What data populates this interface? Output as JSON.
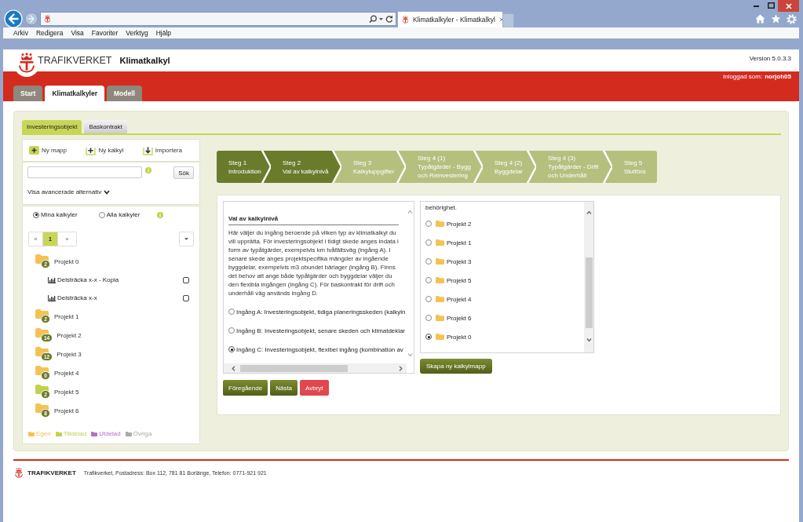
{
  "browser": {
    "tab_title": "Klimatkalkyler - Klimatkalkyl",
    "menu": [
      "Arkiv",
      "Redigera",
      "Visa",
      "Favoriter",
      "Verktyg",
      "Hjälp"
    ]
  },
  "header": {
    "logo_text": "TRAFIKVERKET",
    "app_name": "Klimatkalkyl",
    "version": "Version 5.0.3.3",
    "login_label": "Inloggad som:",
    "username": "norjoh05"
  },
  "main_tabs": [
    {
      "label": "Start",
      "selected": false
    },
    {
      "label": "Klimatkalkyler",
      "selected": true
    },
    {
      "label": "Modell",
      "selected": false
    }
  ],
  "sub_tabs": [
    {
      "label": "Investeringsobjekt",
      "selected": true
    },
    {
      "label": "Baskontrakt",
      "selected": false
    }
  ],
  "sidebar": {
    "toolbar": [
      {
        "label": "Ny mapp",
        "kind": "new_folder"
      },
      {
        "label": "Ny kalkyl",
        "kind": "new_calc"
      },
      {
        "label": "Importera",
        "kind": "import"
      }
    ],
    "search": {
      "button": "Sök"
    },
    "advanced_toggle": "Visa avancerade alternativ",
    "filters": [
      {
        "label": "Mina kalkyler",
        "selected": true
      },
      {
        "label": "Alla kalkyler",
        "selected": false
      }
    ],
    "pagination": {
      "prev": "«",
      "pages": [
        {
          "label": "1",
          "selected": true
        }
      ],
      "next": "»"
    },
    "tree": [
      {
        "kind": "folder",
        "name": "Projekt 0",
        "count": "2",
        "color": "#f5c252",
        "children": [
          {
            "kind": "calculation",
            "name": "Delsträcka x-x - Kopia",
            "checked": false
          },
          {
            "kind": "calculation",
            "name": "Delsträcka x-x",
            "checked": false
          }
        ]
      },
      {
        "kind": "folder",
        "name": "Projekt 1",
        "count": "2",
        "color": "#f5c252"
      },
      {
        "kind": "folder",
        "name": "Projekt 2",
        "count": "14",
        "color": "#f5c252"
      },
      {
        "kind": "folder",
        "name": "Projekt 3",
        "count": "12",
        "color": "#f5c252"
      },
      {
        "kind": "folder",
        "name": "Projekt 4",
        "count": "0",
        "color": "#f5c252"
      },
      {
        "kind": "folder",
        "name": "Projekt 5",
        "count": "2",
        "color": "#c2d14a"
      },
      {
        "kind": "folder",
        "name": "Projekt 6",
        "count": "8",
        "color": "#f5c252"
      }
    ],
    "legend": [
      {
        "label": "Egen",
        "color": "#f5c252"
      },
      {
        "label": "Tilldelad",
        "color": "#c2d14a"
      },
      {
        "label": "Utdelad",
        "color": "#b56fc4"
      },
      {
        "label": "Övriga",
        "color": "#a9a9a9"
      }
    ]
  },
  "steps": [
    {
      "title": "Steg 1",
      "label": "Introduktion",
      "reached": true
    },
    {
      "title": "Steg 2",
      "label": "Val av kalkylnivå",
      "reached": true
    },
    {
      "title": "Steg 3",
      "label": "Kalkyluppgifter",
      "reached": false
    },
    {
      "title": "Steg 4 (1)",
      "label": "Typåtgärder - Bygg och Reinvestering",
      "reached": false
    },
    {
      "title": "Steg 4 (2)",
      "label": "Byggdelar",
      "reached": false
    },
    {
      "title": "Steg 4 (3)",
      "label": "Typåtgärder - Drift och Underhåll",
      "reached": false
    },
    {
      "title": "Steg 5",
      "label": "Slutföra",
      "reached": false
    }
  ],
  "level_panel": {
    "heading": "Val av kalkylnivå",
    "description": "Här väljer du ingång beroende på vilken typ av klimatkalkyl du vill upprätta. För investeringsobjekt i tidigt skede anges indata i form av typåtgärder, exempelvis km tvåfältsväg (ingång A). I senare skede anges projektspecifika mängder av ingående byggdelar, exempelvis m3 obundet bärlager (ingång B). Finns det behov att ange både typåtgärder och byggdelar väljer du den flexibla ingången (ingång C). För baskontrakt för drift och underhåll väg används ingång D.",
    "options": [
      {
        "label": "Ingång A: Investeringsobjekt, tidiga planeringsskeden (kalkyln",
        "selected": false
      },
      {
        "label": "Ingång B: Investeringsobjekt, senare skeden och klimatdeklar",
        "selected": false
      },
      {
        "label": "Ingång C: Investeringsobjekt, flexibel ingång (kombination av",
        "selected": true
      }
    ]
  },
  "folder_panel": {
    "note": "behörighet.",
    "folders": [
      {
        "name": "Projekt 2",
        "selected": false
      },
      {
        "name": "Projekt 1",
        "selected": false
      },
      {
        "name": "Projekt 3",
        "selected": false
      },
      {
        "name": "Projekt 5",
        "selected": false
      },
      {
        "name": "Projekt 4",
        "selected": false
      },
      {
        "name": "Projekt 6",
        "selected": false
      },
      {
        "name": "Projekt 0",
        "selected": true
      }
    ],
    "create_button": "Skapa ny kalkylmapp"
  },
  "actions": [
    {
      "label": "Föregående",
      "kind": "primary"
    },
    {
      "label": "Nästa",
      "kind": "primary"
    },
    {
      "label": "Avbryt",
      "kind": "danger"
    }
  ],
  "footer": {
    "logo_text": "TRAFIKVERKET",
    "address": "Trafikverket, Postadress: Box 112, 781 81 Borlänge, Telefon: 0771-921 921"
  }
}
